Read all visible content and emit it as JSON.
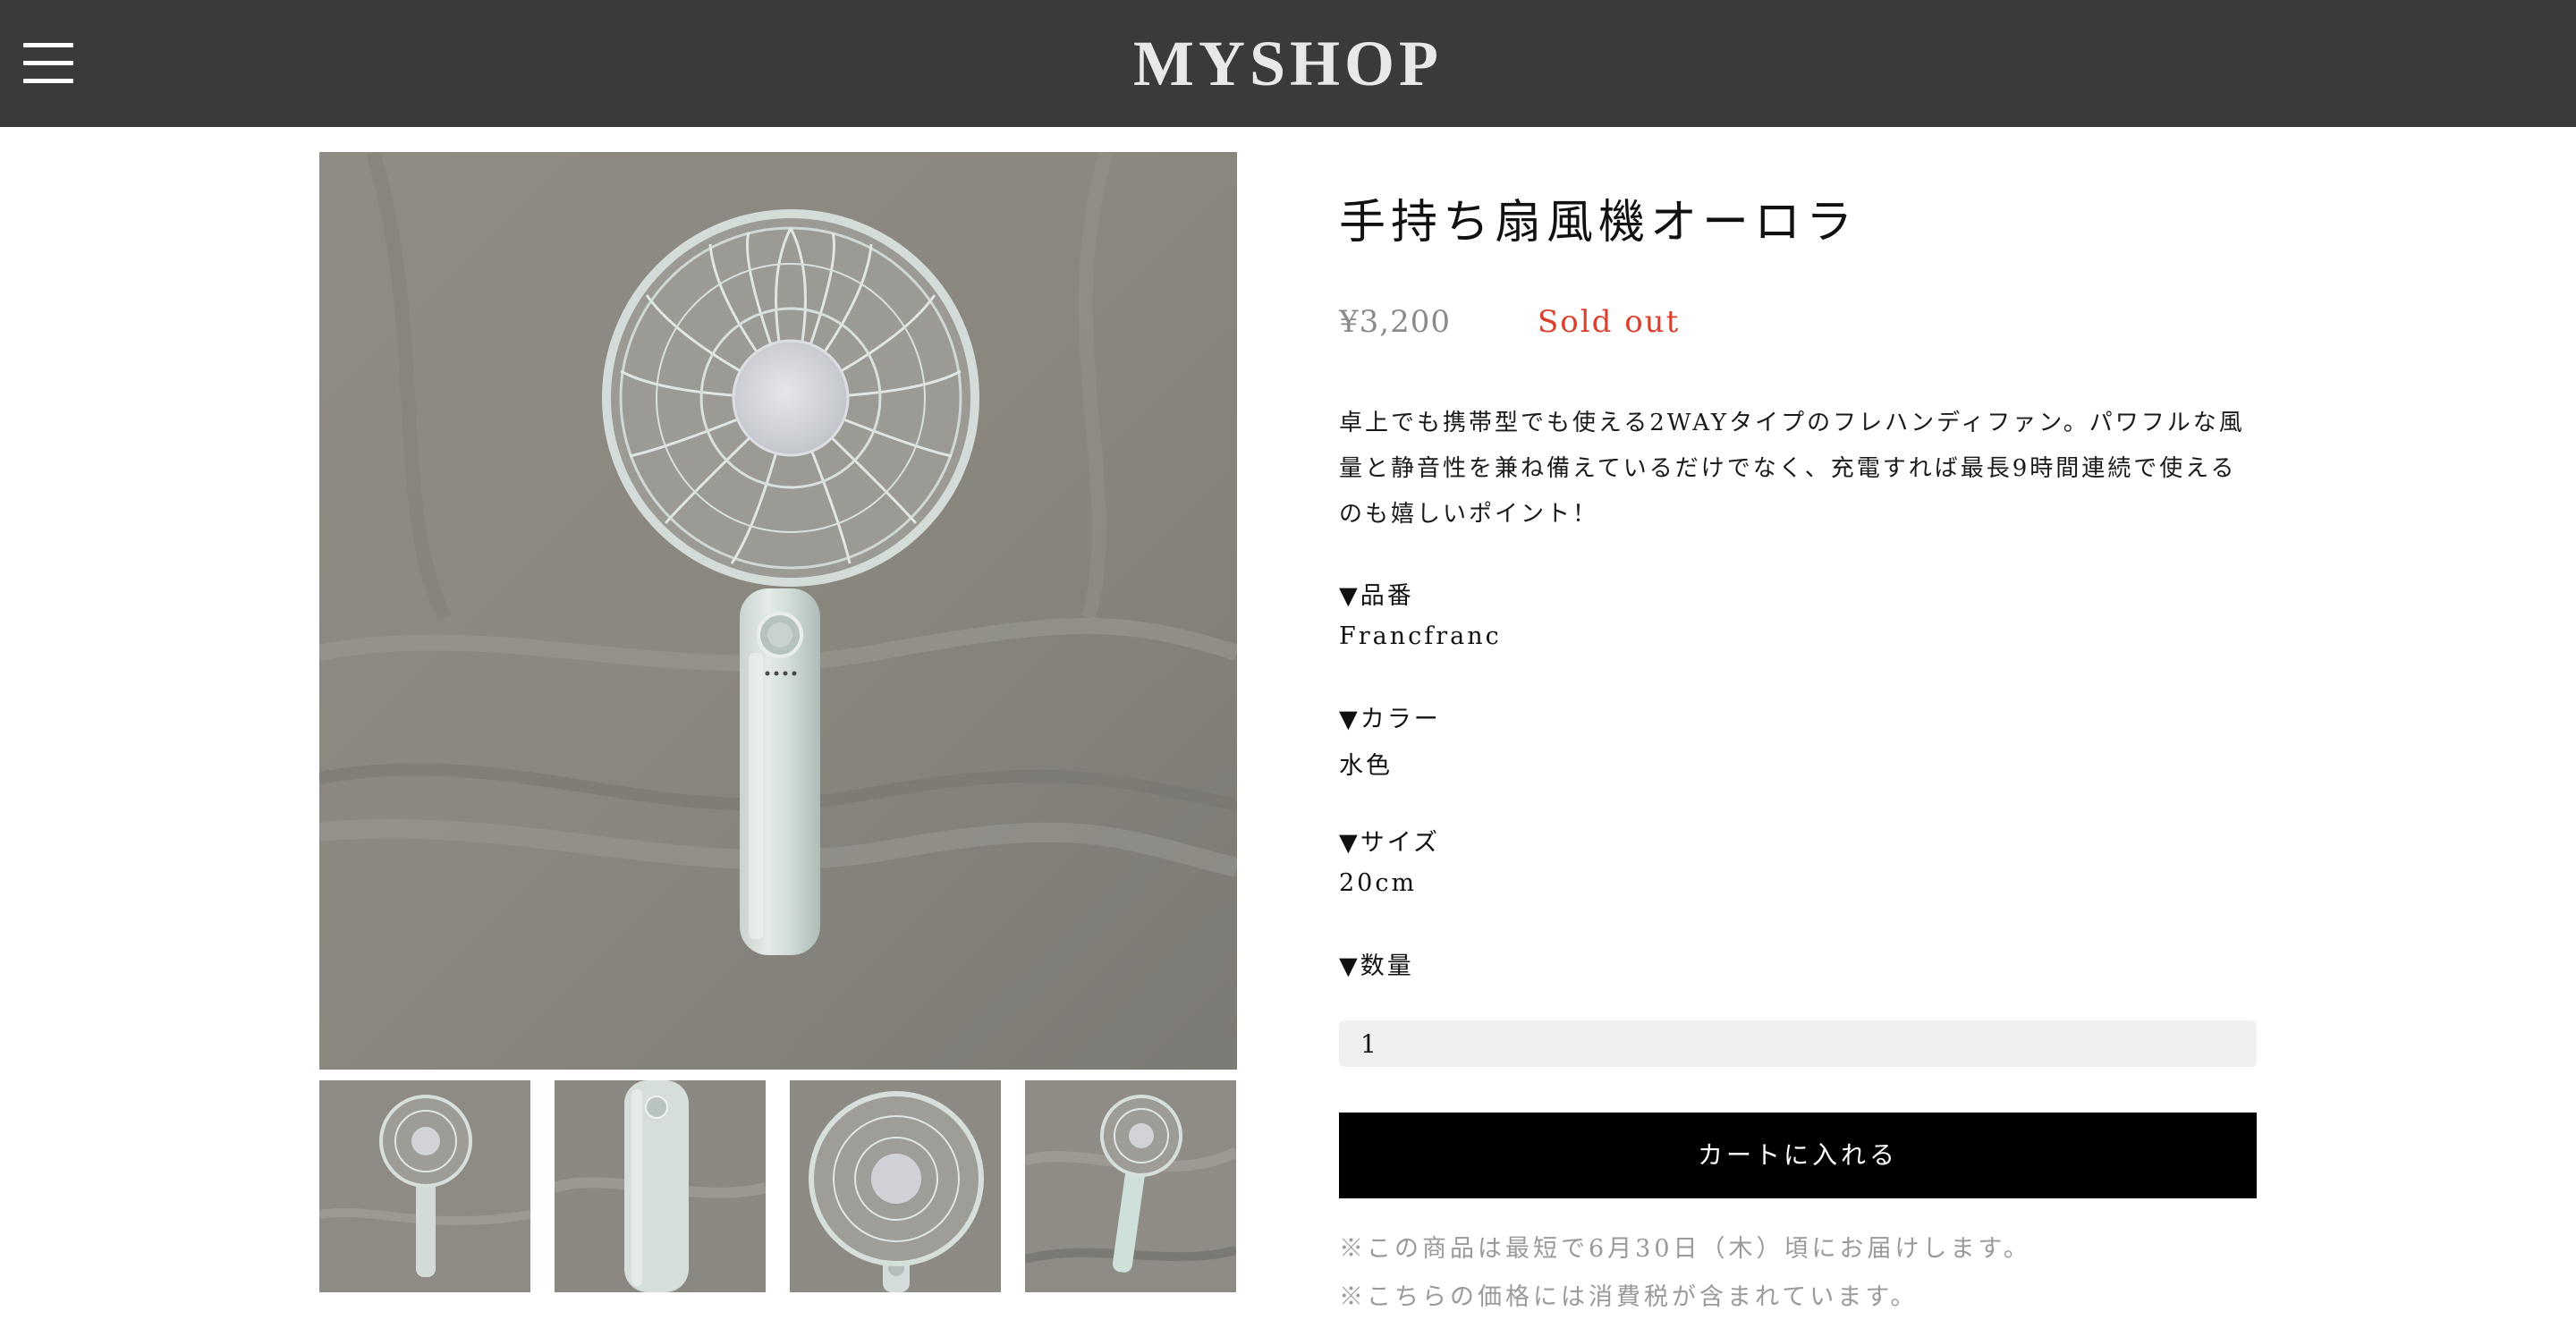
{
  "header": {
    "logo": "MYSHOP",
    "menu_icon": "hamburger-menu-icon"
  },
  "gallery": {
    "main_image": "handheld-fan-photo",
    "thumbnails": [
      "fan-front-thumb",
      "fan-handle-thumb",
      "fan-head-closeup-thumb",
      "fan-angled-thumb"
    ],
    "brand_on_product": "Francfranc"
  },
  "product": {
    "title": "手持ち扇風機オーロラ",
    "price": "¥3,200",
    "status": "Sold out",
    "description": "卓上でも携帯型でも使える2WAYタイプのフレハンディファン。パワフルな風量と静音性を兼ね備えているだけでなく、充電すれば最長9時間連続で使えるのも嬉しいポイント！",
    "specs": {
      "model_label": "▼品番",
      "model_value": "Francfranc",
      "color_label": "▼カラー",
      "color_value": "水色",
      "size_label": "▼サイズ",
      "size_value": "20cm",
      "quantity_label": "▼数量"
    },
    "quantity": "1",
    "cart_button": "カートに入れる",
    "notes": [
      "※この商品は最短で6月30日（木）頃にお届けします。",
      "※こちらの価格には消費税が含まれています。"
    ]
  },
  "colors": {
    "header_bg": "#3a3a3a",
    "sold_out": "#d8412e",
    "button_bg": "#000000"
  }
}
